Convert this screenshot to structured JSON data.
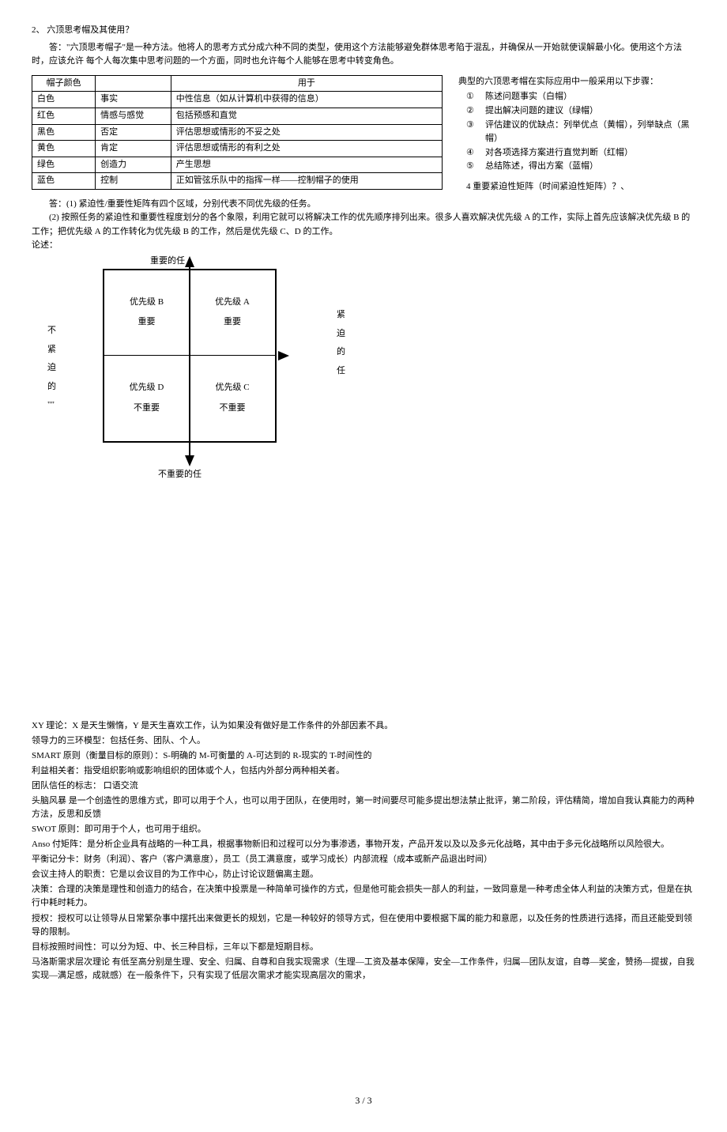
{
  "q2": {
    "title": "2、  六顶思考帽及其使用？",
    "answer": "答：\"六顶思考帽子\"是一种方法。他将人的思考方式分成六种不同的类型，使用这个方法能够避免群体思考陷于混乱，并确保从一开始就使误解最小化。使用这个方法时，应该允许 每个人每次集中思考问题的一个方面，同时也允许每个人能够在思考中转变角色。"
  },
  "hats_table": {
    "headers": [
      "帽子颜色",
      "",
      "用于"
    ],
    "rows": [
      {
        "color": "白色",
        "core": "事实",
        "use": "中性信息（如从计算机中获得的信息）"
      },
      {
        "color": "红色",
        "core": "情感与感觉",
        "use": "包括预感和直觉"
      },
      {
        "color": "黑色",
        "core": "否定",
        "use": "评估思想或情形的不妥之处"
      },
      {
        "color": "黄色",
        "core": "肯定",
        "use": "评估思想或情形的有利之处"
      },
      {
        "color": "绿色",
        "core": "创造力",
        "use": "产生思想"
      },
      {
        "color": "蓝色",
        "core": "控制",
        "use": "正如管弦乐队中的指挥一样——控制帽子的使用"
      }
    ]
  },
  "steps": {
    "title": "典型的六顶思考帽在实际应用中一般采用以下步骤：",
    "items": [
      {
        "num": "①",
        "text": "陈述问题事实（白帽）"
      },
      {
        "num": "②",
        "text": "提出解决问题的建议（绿帽）"
      },
      {
        "num": "③",
        "text": "评估建议的优缺点：列举优点（黄帽），列举缺点（黑帽）"
      },
      {
        "num": "④",
        "text": "对各项选择方案进行直觉判断（红帽）"
      },
      {
        "num": "⑤",
        "text": "总结陈述，得出方案（蓝帽）"
      }
    ],
    "q4": "4 重要紧迫性矩阵（时间紧迫性矩阵）？、"
  },
  "answer2": {
    "l1": "答：(1) 紧迫性/重要性矩阵有四个区域，分别代表不同优先级的任务。",
    "l2": "(2) 按照任务的紧迫性和重要性程度划分的各个象限，利用它就可以将解决工作的优先顺序排列出来。很多人喜欢解决优先级 A 的工作，实际上首先应该解决优先级 B 的工作；把优先级 A 的工作转化为优先级 B 的工作，然后是优先级 C、D 的工作。",
    "l3": "论述："
  },
  "quadrant": {
    "top": "重要的任",
    "bottom": "不重要的任",
    "left": [
      "不",
      "紧",
      "迫",
      "的",
      "\"\""
    ],
    "right": [
      "紧",
      "迫",
      "的",
      "任"
    ],
    "q1": {
      "line1": "优先级 B",
      "line2": "重要"
    },
    "q2": {
      "line1": "优先级 A",
      "line2": "重要"
    },
    "q3": {
      "line1": "优先级 D",
      "line2": "不重要"
    },
    "q4": {
      "line1": "优先级 C",
      "line2": "不重要"
    }
  },
  "notes": {
    "p": [
      "XY 理论：X 是天生懒惰，Y 是天生喜欢工作，认为如果没有做好是工作条件的外部因素不具。",
      "领导力的三环模型：包括任务、团队、个人。",
      "SMART 原则（衡量目标的原则）：S-明确的  M-可衡量的 A-可达到的 R-现实的 T-时间性的",
      "利益相关者：指受组织影响或影响组织的团体或个人，包括内外部分两种相关者。",
      "团队信任的标志： 口语交流",
      "头脑风暴 是一个创造性的思维方式，即可以用于个人，也可以用于团队，在使用时，第一时间要尽可能多提出想法禁止批评，第二阶段，评估精简，增加自我认真能力的两种方法，反思和反馈",
      "SWOT 原则：即可用于个人，也可用于组织。",
      "Anso 付矩阵：是分析企业具有战略的一种工具，根据事物新旧和过程可以分为事渗透，事物开发，产品开发以及以及多元化战略，其中由于多元化战略所以风险很大。",
      "平衡记分卡：财务（利润）、客户（客户满意度），员工（员工满意度，或学习成长）内部流程（成本或新产品退出时间）",
      "会议主持人的职责：它是以会议目的为工作中心，防止讨论议题偏离主题。",
      "决策：合理的决策是理性和创造力的结合，在决策中投票是一种简单可操作的方式，但是他可能会损失一部人的利益，一致同意是一种考虑全体人利益的决策方式，但是在执行中耗时耗力。",
      "授权：授权可以让领导从日常繁杂事中摆托出来做更长的规划，它是一种较好的领导方式，但在使用中要根据下属的能力和意愿，以及任务的性质进行选择，而且还能受到领导的限制。",
      "目标按照时间性：可以分为短、中、长三种目标，三年以下都是短期目标。",
      "马洛斯需求层次理论 有低至高分别是生理、安全、归属、自尊和自我实现需求（生理—工资及基本保障，安全—工作条件，归属—团队友谊，自尊—奖金，赞扬—提拔，自我实现—满足感，成就感）在一般条件下，只有实现了低层次需求才能实现高层次的需求，"
    ]
  },
  "pagenum": "3 / 3"
}
